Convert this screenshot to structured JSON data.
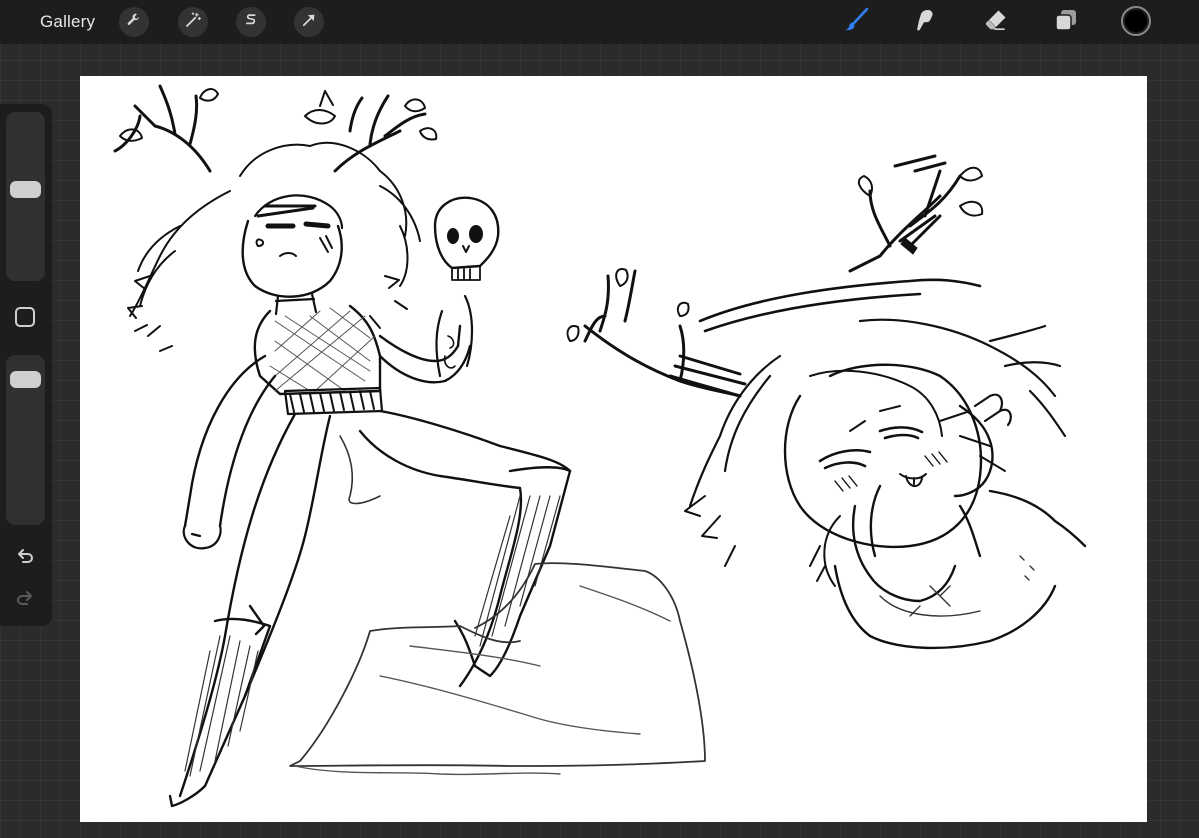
{
  "topbar": {
    "gallery_label": "Gallery",
    "left_tools": [
      {
        "icon": "wrench-icon",
        "name": "actions"
      },
      {
        "icon": "magic-wand-icon",
        "name": "adjustments"
      },
      {
        "icon": "selection-s-icon",
        "name": "selection"
      },
      {
        "icon": "transform-arrow-icon",
        "name": "transform"
      }
    ],
    "right_tools": [
      {
        "icon": "brush-icon",
        "name": "paint",
        "active": true
      },
      {
        "icon": "smudge-icon",
        "name": "smudge"
      },
      {
        "icon": "eraser-icon",
        "name": "erase"
      },
      {
        "icon": "layers-icon",
        "name": "layers"
      }
    ],
    "current_color": "#000000"
  },
  "sidebar": {
    "brush_size_level": 0.55,
    "opacity_level": 0.92
  },
  "colors": {
    "active_tool": "#2f7ff0",
    "icon": "#d8d8da",
    "toolbar_bg": "#1d1d1e",
    "workspace_bg": "#2b2b2d",
    "canvas_bg": "#ffffff"
  }
}
